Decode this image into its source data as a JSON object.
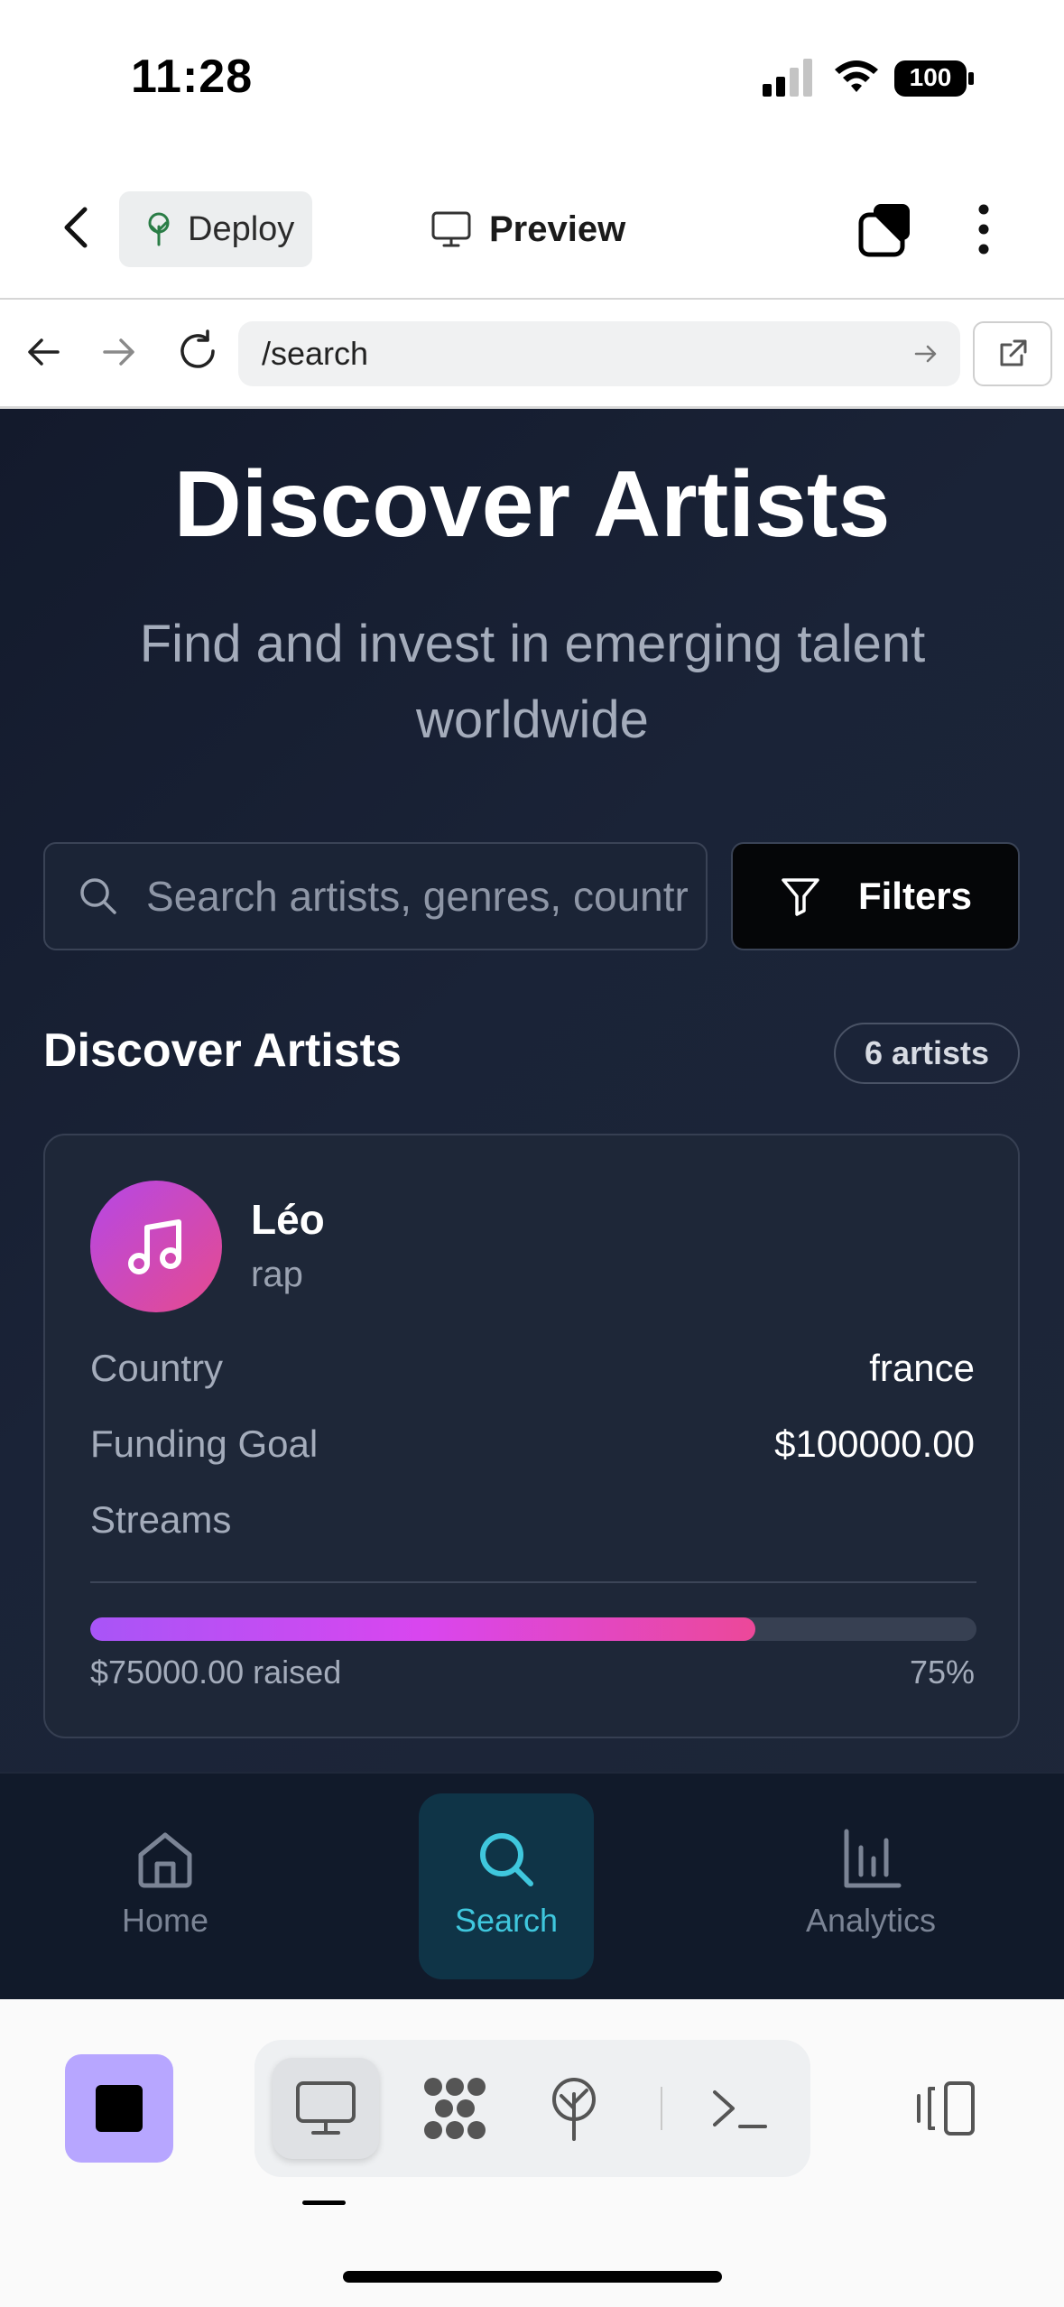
{
  "status_bar": {
    "time": "11:28",
    "battery": "100"
  },
  "header": {
    "deploy_label": "Deploy",
    "preview_label": "Preview"
  },
  "browser": {
    "url": "/search"
  },
  "page": {
    "title": "Discover Artists",
    "subtitle": "Find and invest in emerging talent worldwide",
    "search_placeholder": "Search artists, genres, countries...",
    "filters_label": "Filters",
    "section_title": "Discover Artists",
    "artist_count": "6 artists"
  },
  "artist": {
    "name": "Léo",
    "genre": "rap",
    "country_label": "Country",
    "country": "france",
    "funding_label": "Funding Goal",
    "funding_goal": "$100000.00",
    "streams_label": "Streams",
    "raised": "$75000.00 raised",
    "percent": "75%",
    "progress_fraction": 0.75
  },
  "bottom_nav": {
    "items": [
      {
        "label": "Home",
        "icon": "home-icon",
        "active": false
      },
      {
        "label": "Search",
        "icon": "search-icon",
        "active": true
      },
      {
        "label": "Analytics",
        "icon": "bar-chart-icon",
        "active": false
      }
    ]
  },
  "colors": {
    "accent_active": "#3fc7dd",
    "progress_start": "#a855f7",
    "progress_end": "#ec4899",
    "stop_button": "#b7a6ff"
  }
}
